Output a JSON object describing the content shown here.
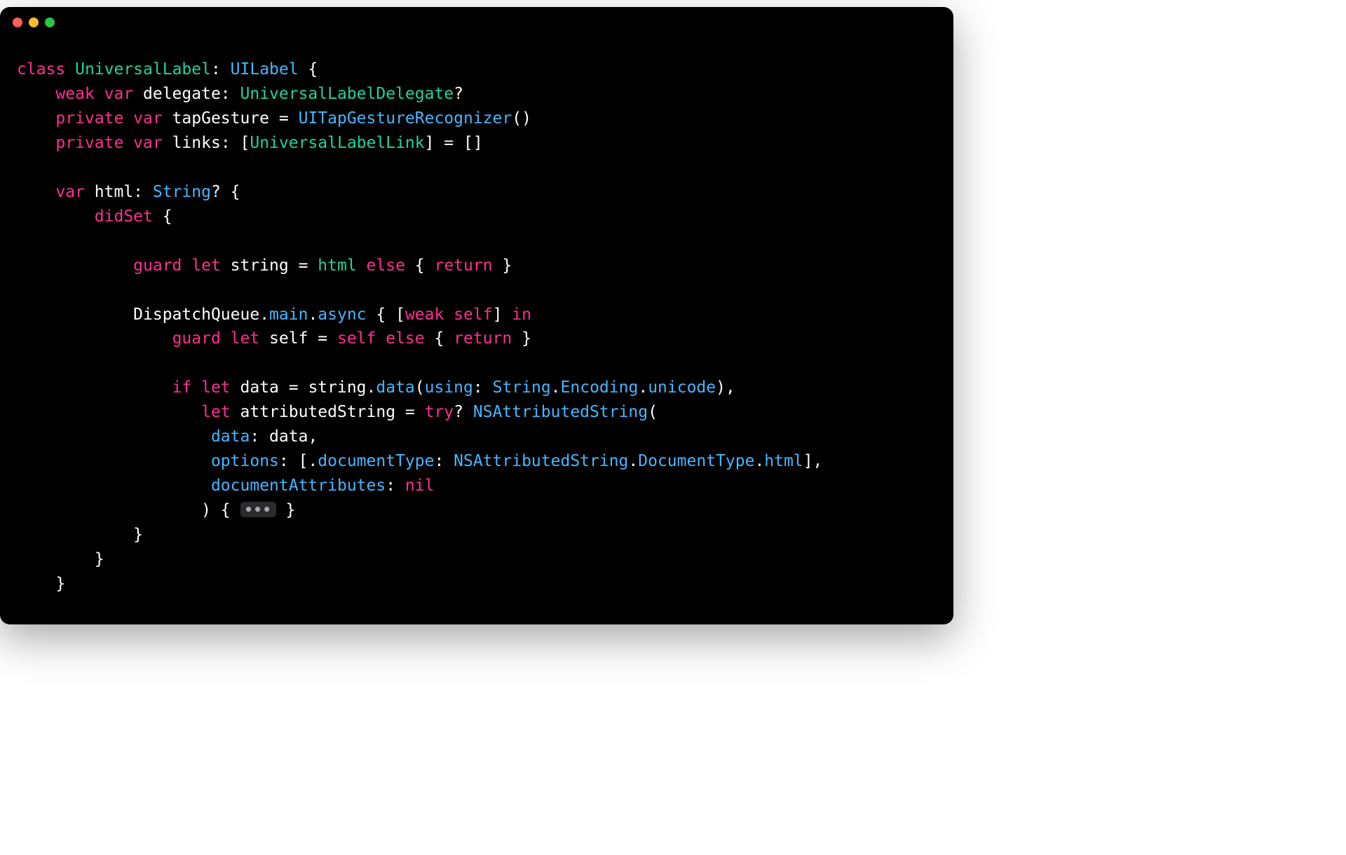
{
  "window": {
    "traffic_lights": [
      "close",
      "minimize",
      "zoom"
    ]
  },
  "colors": {
    "keyword": "#ff2f92",
    "type": "#46b6ff",
    "user_type": "#1fd3a0",
    "plain": "#ffffff",
    "bg": "#000000"
  },
  "code": {
    "fold_glyph": "•••",
    "lines": [
      [
        {
          "t": "class ",
          "c": "kw"
        },
        {
          "t": "UniversalLabel",
          "c": "usr"
        },
        {
          "t": ": ",
          "c": "punct"
        },
        {
          "t": "UILabel",
          "c": "type"
        },
        {
          "t": " {",
          "c": "punct"
        }
      ],
      [
        {
          "t": "    ",
          "c": "punct"
        },
        {
          "t": "weak var ",
          "c": "kw"
        },
        {
          "t": "delegate",
          "c": "ident"
        },
        {
          "t": ": ",
          "c": "punct"
        },
        {
          "t": "UniversalLabelDelegate",
          "c": "usr"
        },
        {
          "t": "?",
          "c": "punct"
        }
      ],
      [
        {
          "t": "    ",
          "c": "punct"
        },
        {
          "t": "private var ",
          "c": "kw"
        },
        {
          "t": "tapGesture",
          "c": "ident"
        },
        {
          "t": " = ",
          "c": "punct"
        },
        {
          "t": "UITapGestureRecognizer",
          "c": "type"
        },
        {
          "t": "()",
          "c": "punct"
        }
      ],
      [
        {
          "t": "    ",
          "c": "punct"
        },
        {
          "t": "private var ",
          "c": "kw"
        },
        {
          "t": "links",
          "c": "ident"
        },
        {
          "t": ": [",
          "c": "punct"
        },
        {
          "t": "UniversalLabelLink",
          "c": "usr"
        },
        {
          "t": "] = []",
          "c": "punct"
        }
      ],
      [],
      [
        {
          "t": "    ",
          "c": "punct"
        },
        {
          "t": "var ",
          "c": "kw"
        },
        {
          "t": "html",
          "c": "ident"
        },
        {
          "t": ": ",
          "c": "punct"
        },
        {
          "t": "String",
          "c": "type"
        },
        {
          "t": "? {",
          "c": "punct"
        }
      ],
      [
        {
          "t": "        ",
          "c": "punct"
        },
        {
          "t": "didSet",
          "c": "kw"
        },
        {
          "t": " {",
          "c": "punct"
        }
      ],
      [],
      [
        {
          "t": "            ",
          "c": "punct"
        },
        {
          "t": "guard let ",
          "c": "kw"
        },
        {
          "t": "string",
          "c": "ident"
        },
        {
          "t": " = ",
          "c": "punct"
        },
        {
          "t": "html",
          "c": "usr"
        },
        {
          "t": " ",
          "c": "punct"
        },
        {
          "t": "else",
          "c": "kw"
        },
        {
          "t": " { ",
          "c": "punct"
        },
        {
          "t": "return",
          "c": "kw"
        },
        {
          "t": " }",
          "c": "punct"
        }
      ],
      [],
      [
        {
          "t": "            ",
          "c": "punct"
        },
        {
          "t": "DispatchQueue",
          "c": "ident"
        },
        {
          "t": ".",
          "c": "punct"
        },
        {
          "t": "main",
          "c": "type"
        },
        {
          "t": ".",
          "c": "punct"
        },
        {
          "t": "async",
          "c": "type"
        },
        {
          "t": " { [",
          "c": "punct"
        },
        {
          "t": "weak self",
          "c": "kw"
        },
        {
          "t": "] ",
          "c": "punct"
        },
        {
          "t": "in",
          "c": "kw"
        }
      ],
      [
        {
          "t": "                ",
          "c": "punct"
        },
        {
          "t": "guard let ",
          "c": "kw"
        },
        {
          "t": "self",
          "c": "ident"
        },
        {
          "t": " = ",
          "c": "punct"
        },
        {
          "t": "self",
          "c": "kw"
        },
        {
          "t": " ",
          "c": "punct"
        },
        {
          "t": "else",
          "c": "kw"
        },
        {
          "t": " { ",
          "c": "punct"
        },
        {
          "t": "return",
          "c": "kw"
        },
        {
          "t": " }",
          "c": "punct"
        }
      ],
      [],
      [
        {
          "t": "                ",
          "c": "punct"
        },
        {
          "t": "if let ",
          "c": "kw"
        },
        {
          "t": "data",
          "c": "ident"
        },
        {
          "t": " = ",
          "c": "punct"
        },
        {
          "t": "string",
          "c": "ident"
        },
        {
          "t": ".",
          "c": "punct"
        },
        {
          "t": "data",
          "c": "type"
        },
        {
          "t": "(",
          "c": "punct"
        },
        {
          "t": "using",
          "c": "param"
        },
        {
          "t": ": ",
          "c": "punct"
        },
        {
          "t": "String",
          "c": "type"
        },
        {
          "t": ".",
          "c": "punct"
        },
        {
          "t": "Encoding",
          "c": "type"
        },
        {
          "t": ".",
          "c": "punct"
        },
        {
          "t": "unicode",
          "c": "type"
        },
        {
          "t": "),",
          "c": "punct"
        }
      ],
      [
        {
          "t": "                   ",
          "c": "punct"
        },
        {
          "t": "let ",
          "c": "kw"
        },
        {
          "t": "attributedString",
          "c": "ident"
        },
        {
          "t": " = ",
          "c": "punct"
        },
        {
          "t": "try",
          "c": "kw"
        },
        {
          "t": "? ",
          "c": "punct"
        },
        {
          "t": "NSAttributedString",
          "c": "type"
        },
        {
          "t": "(",
          "c": "punct"
        }
      ],
      [
        {
          "t": "                    ",
          "c": "punct"
        },
        {
          "t": "data",
          "c": "param"
        },
        {
          "t": ": ",
          "c": "punct"
        },
        {
          "t": "data",
          "c": "ident"
        },
        {
          "t": ",",
          "c": "punct"
        }
      ],
      [
        {
          "t": "                    ",
          "c": "punct"
        },
        {
          "t": "options",
          "c": "param"
        },
        {
          "t": ": [.",
          "c": "punct"
        },
        {
          "t": "documentType",
          "c": "type"
        },
        {
          "t": ": ",
          "c": "punct"
        },
        {
          "t": "NSAttributedString",
          "c": "type"
        },
        {
          "t": ".",
          "c": "punct"
        },
        {
          "t": "DocumentType",
          "c": "type"
        },
        {
          "t": ".",
          "c": "punct"
        },
        {
          "t": "html",
          "c": "type"
        },
        {
          "t": "],",
          "c": "punct"
        }
      ],
      [
        {
          "t": "                    ",
          "c": "punct"
        },
        {
          "t": "documentAttributes",
          "c": "param"
        },
        {
          "t": ": ",
          "c": "punct"
        },
        {
          "t": "nil",
          "c": "kw"
        }
      ],
      [
        {
          "t": "                   ) { ",
          "c": "punct"
        },
        {
          "t": "FOLD",
          "c": "fold"
        },
        {
          "t": " }",
          "c": "punct"
        }
      ],
      [
        {
          "t": "            }",
          "c": "punct"
        }
      ],
      [
        {
          "t": "        }",
          "c": "punct"
        }
      ],
      [
        {
          "t": "    }",
          "c": "punct"
        }
      ]
    ]
  }
}
